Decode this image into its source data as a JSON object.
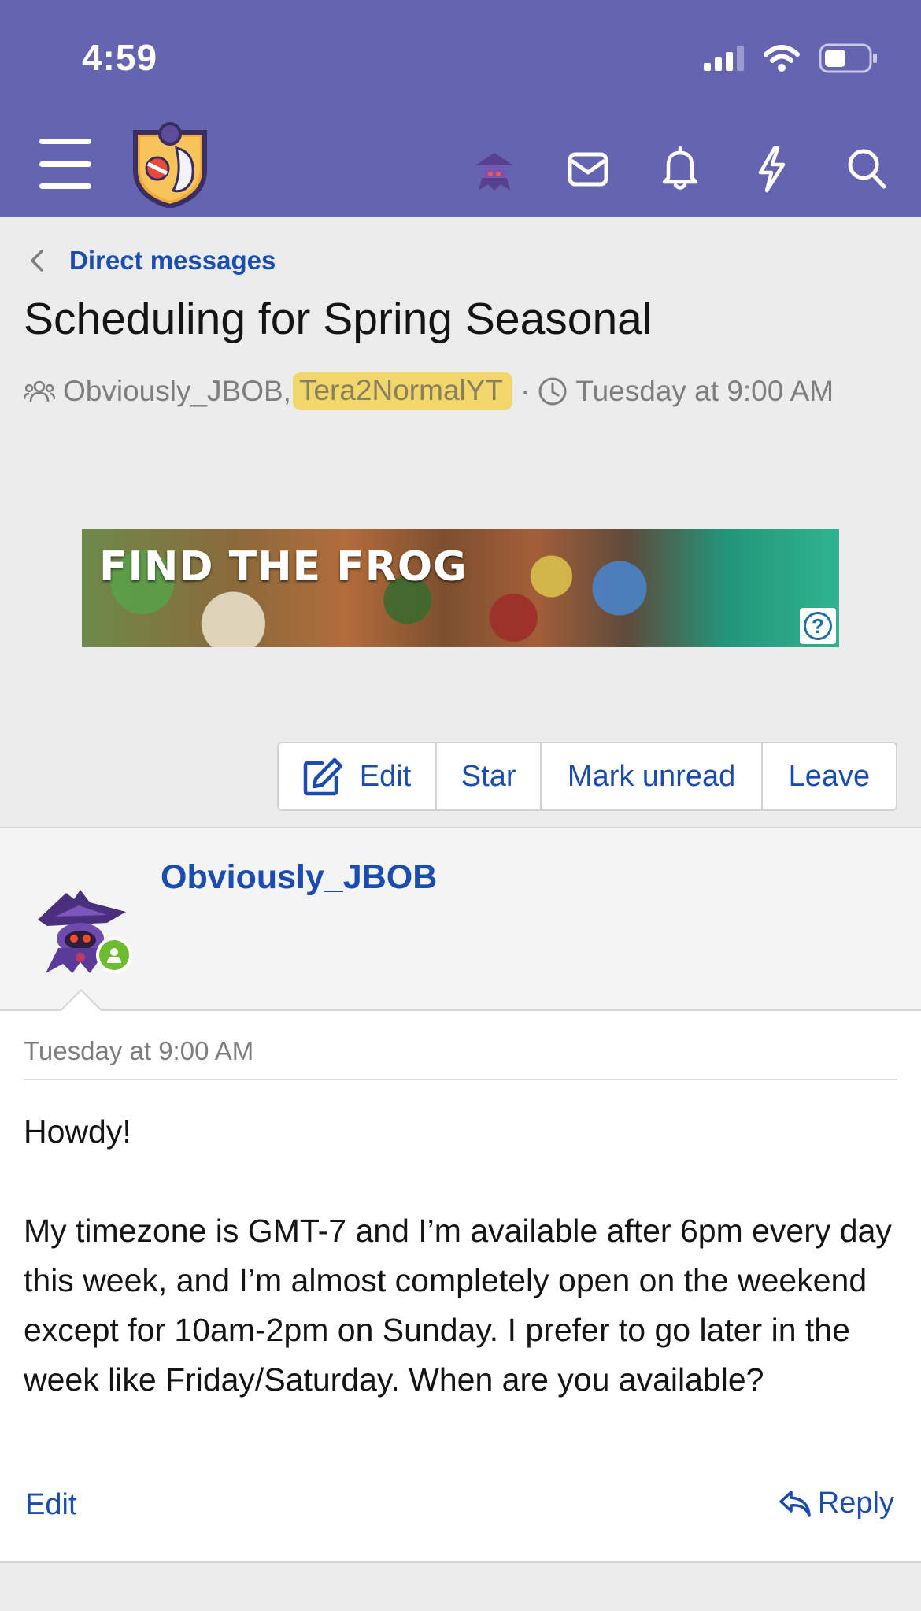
{
  "status_bar": {
    "time": "4:59"
  },
  "header": {
    "icons": [
      "menu-icon",
      "site-logo",
      "user-avatar",
      "mail-icon",
      "bell-icon",
      "bolt-icon",
      "search-icon"
    ],
    "colors": {
      "background": "#6564b0"
    }
  },
  "breadcrumb": {
    "label": "Direct messages"
  },
  "conversation": {
    "title": "Scheduling for Spring Seasonal",
    "participants": [
      "Obviously_JBOB,",
      "Tera2NormalYT"
    ],
    "separator": "·",
    "time": "Tuesday at 9:00 AM"
  },
  "ad": {
    "headline": "FIND THE FROG",
    "help_symbol": "?"
  },
  "actions": {
    "edit": "Edit",
    "star": "Star",
    "mark_unread": "Mark unread",
    "leave": "Leave"
  },
  "message": {
    "author": "Obviously_JBOB",
    "time": "Tuesday at 9:00 AM",
    "body": "Howdy!\n\nMy timezone is GMT-7 and I’m available after 6pm every day this week, and I’m almost completely open on the weekend except for 10am-2pm on Sunday. I prefer to go later in the week like Friday/Saturday. When are you available?",
    "edit_label": "Edit",
    "reply_label": "Reply"
  },
  "colors": {
    "link": "#1b4db1",
    "online": "#6dbb2f",
    "highlight": "#f1d66a"
  }
}
